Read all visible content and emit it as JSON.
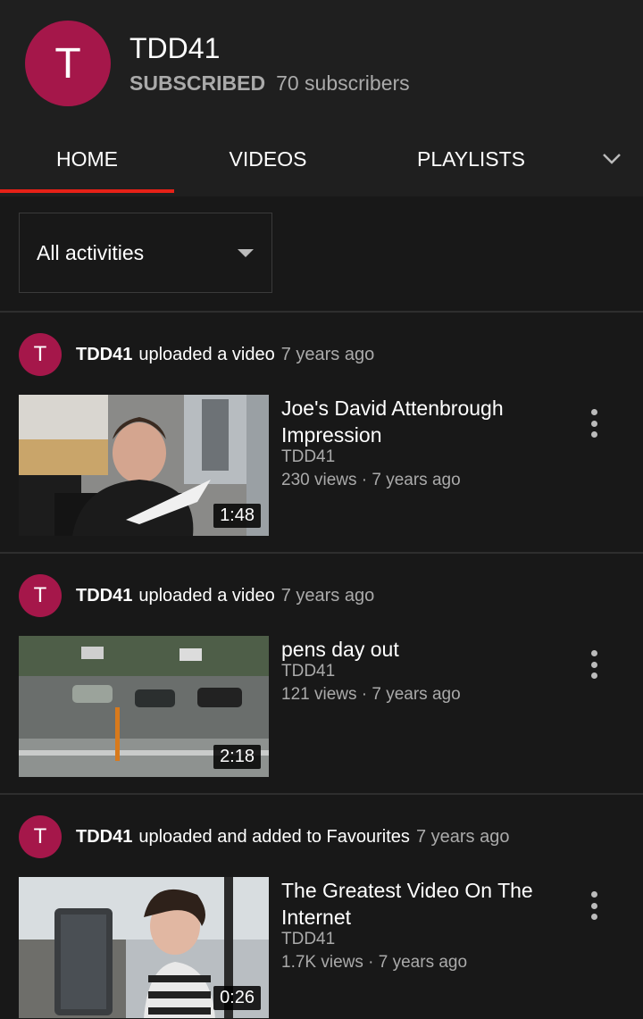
{
  "channel": {
    "avatar_letter": "T",
    "name": "TDD41",
    "subscription_status": "SUBSCRIBED",
    "subscriber_count": "70 subscribers",
    "avatar_color": "#a5174a"
  },
  "tabs": {
    "home": "HOME",
    "videos": "VIDEOS",
    "playlists": "PLAYLISTS",
    "active_indicator_color": "#e62117",
    "more_icon": "chevron-down-icon"
  },
  "filter": {
    "selected": "All activities",
    "icon": "dropdown-caret-icon"
  },
  "activities": [
    {
      "avatar_letter": "T",
      "channel": "TDD41",
      "action": "uploaded a video",
      "time": "7 years ago",
      "video": {
        "title": "Joe's David Attenbrough Impression",
        "channel": "TDD41",
        "meta": "230 views · 7 years ago",
        "duration": "1:48"
      }
    },
    {
      "avatar_letter": "T",
      "channel": "TDD41",
      "action": "uploaded a video",
      "time": "7 years ago",
      "video": {
        "title": "pens day out",
        "channel": "TDD41",
        "meta": "121 views · 7 years ago",
        "duration": "2:18"
      }
    },
    {
      "avatar_letter": "T",
      "channel": "TDD41",
      "action": "uploaded and added to Favourites",
      "time": "7 years ago",
      "video": {
        "title": "The Greatest Video On The Internet",
        "channel": "TDD41",
        "meta": "1.7K views · 7 years ago",
        "duration": "0:26"
      }
    }
  ]
}
